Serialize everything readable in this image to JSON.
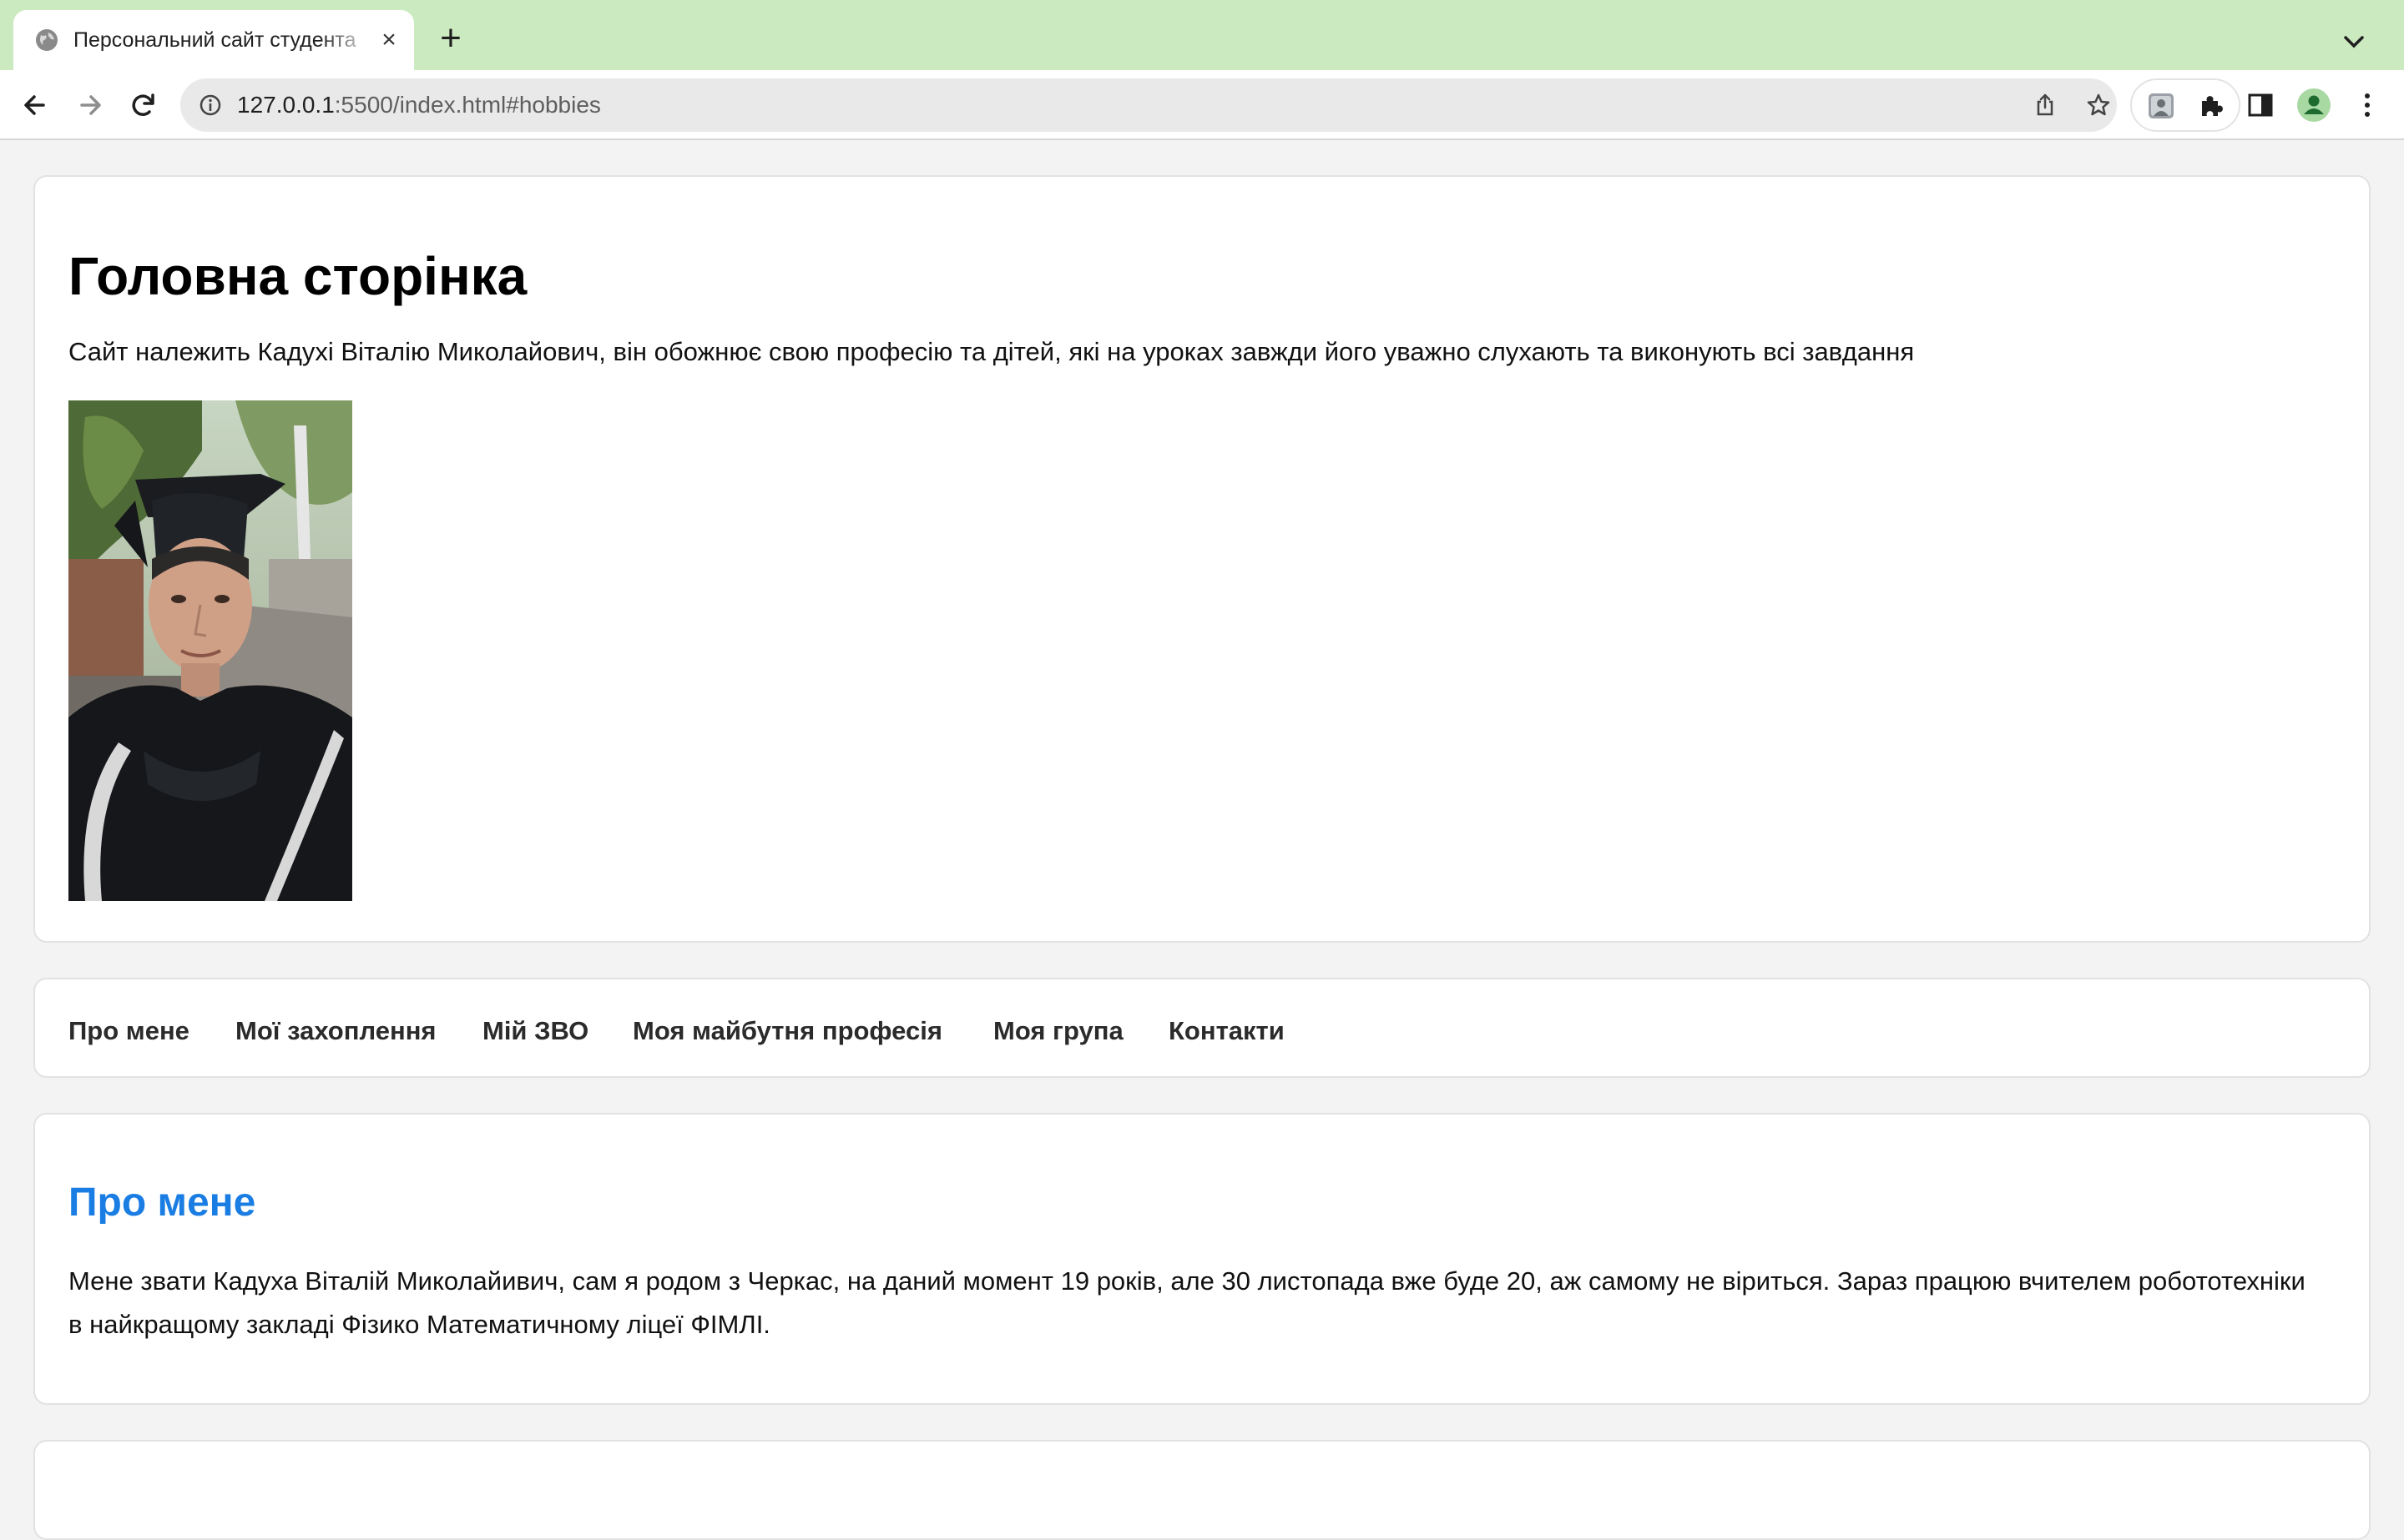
{
  "browser": {
    "tab_title": "Персональний сайт студента",
    "tab_close": "×",
    "new_tab": "+",
    "url_host": "127.0.0.1",
    "url_rest": ":5500/index.html#hobbies"
  },
  "header": {
    "title": "Головна сторінка",
    "intro": "Сайт належить Кадухі Віталію Миколайович, він обожнює свою професію та дітей, які на уроках завжди його уважно слухають та виконують всі завдання"
  },
  "nav": {
    "items": [
      "Про мене",
      "Мої захоплення",
      "Мій ЗВО",
      "Моя майбутня професія",
      "Моя група",
      "Контакти"
    ]
  },
  "about": {
    "title": "Про мене",
    "text": "Мене звати Кадуха Віталій Миколайивич, сам я родом з Черкас, на даний момент 19 років, але 30 листопада вже буде 20, аж самому не віриться. Зараз працюю вчителем робототехніки в найкращому закладі Фізико Математичному ліцеї ФІМЛІ."
  },
  "colors": {
    "tabstrip": "#cbeac0",
    "heading_accent": "#1a7de3",
    "page_bg": "#f3f3f3"
  },
  "icons": [
    "globe-icon",
    "close-icon",
    "plus-icon",
    "chevron-down-icon",
    "back-arrow-icon",
    "forward-arrow-icon",
    "reload-icon",
    "info-icon",
    "share-icon",
    "star-icon",
    "extension-avatar-icon",
    "puzzle-icon",
    "side-panel-icon",
    "profile-icon",
    "kebab-menu-icon"
  ]
}
